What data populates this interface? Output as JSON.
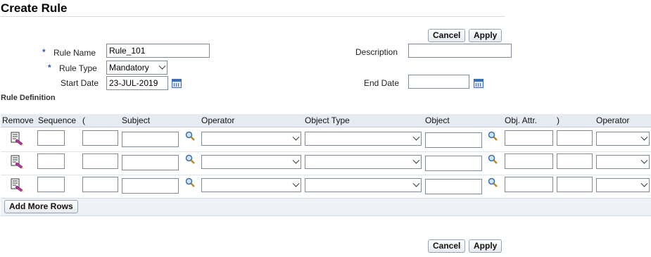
{
  "page": {
    "title": "Create Rule"
  },
  "buttons": {
    "cancel": "Cancel",
    "apply": "Apply",
    "add_more_rows": "Add More Rows"
  },
  "form": {
    "required_marker": "*",
    "rule_name": {
      "label": "Rule Name",
      "value": "Rule_101"
    },
    "rule_type": {
      "label": "Rule Type",
      "value": "Mandatory"
    },
    "start_date": {
      "label": "Start Date",
      "value": "23-JUL-2019"
    },
    "description": {
      "label": "Description",
      "value": ""
    },
    "end_date": {
      "label": "End Date",
      "value": ""
    }
  },
  "rule_definition": {
    "title": "Rule Definition",
    "columns": [
      "Remove",
      "Sequence",
      "(",
      "Subject",
      "Operator",
      "Object Type",
      "Object",
      "Obj. Attr.",
      ")",
      "Operator"
    ],
    "row_count": 3
  },
  "icons": {
    "calendar": "calendar-icon",
    "search": "search-icon",
    "remove": "remove-row-icon"
  },
  "colors": {
    "header_bg": "#e6ebf1",
    "required": "#2a5aa8",
    "border": "#7f8a96"
  }
}
